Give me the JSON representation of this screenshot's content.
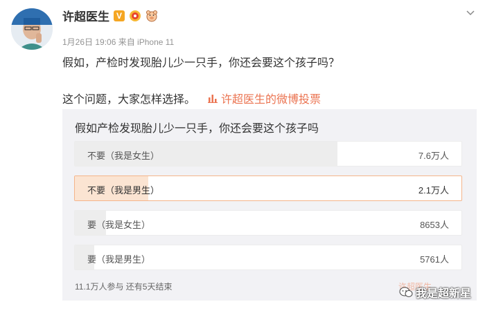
{
  "post": {
    "username": "许超医生",
    "verified_badge": "V",
    "timestamp": "1月26日 19:06 来自 iPhone 11",
    "text_line1": "假如，产检时发现胎儿少一只手，你还会要这个孩子吗？",
    "text_line2": "这个问题，大家怎样选择。",
    "vote_link": "许超医生的微博投票",
    "accent_color": "#eb7350"
  },
  "poll": {
    "question": "假如产检发现胎儿少一只手，你还会要这个孩子吗",
    "options": [
      {
        "label": "不要（我是女生）",
        "count": "7.6万人",
        "fill_fraction": 0.68,
        "selected": false
      },
      {
        "label": "不要（我是男生）",
        "count": "2.1万人",
        "fill_fraction": 0.19,
        "selected": true
      },
      {
        "label": "要（我是女生）",
        "count": "8653人",
        "fill_fraction": 0.08,
        "selected": false
      },
      {
        "label": "要（我是男生）",
        "count": "5761人",
        "fill_fraction": 0.05,
        "selected": false
      }
    ],
    "footer": "11.1万人参与  还有5天结束"
  },
  "watermark": {
    "text": "我是超新星",
    "faint_text": "许超医生"
  },
  "icons": {
    "chevron": "chevron-down-icon",
    "vote": "bar-chart-icon",
    "wechat": "wechat-icon"
  }
}
